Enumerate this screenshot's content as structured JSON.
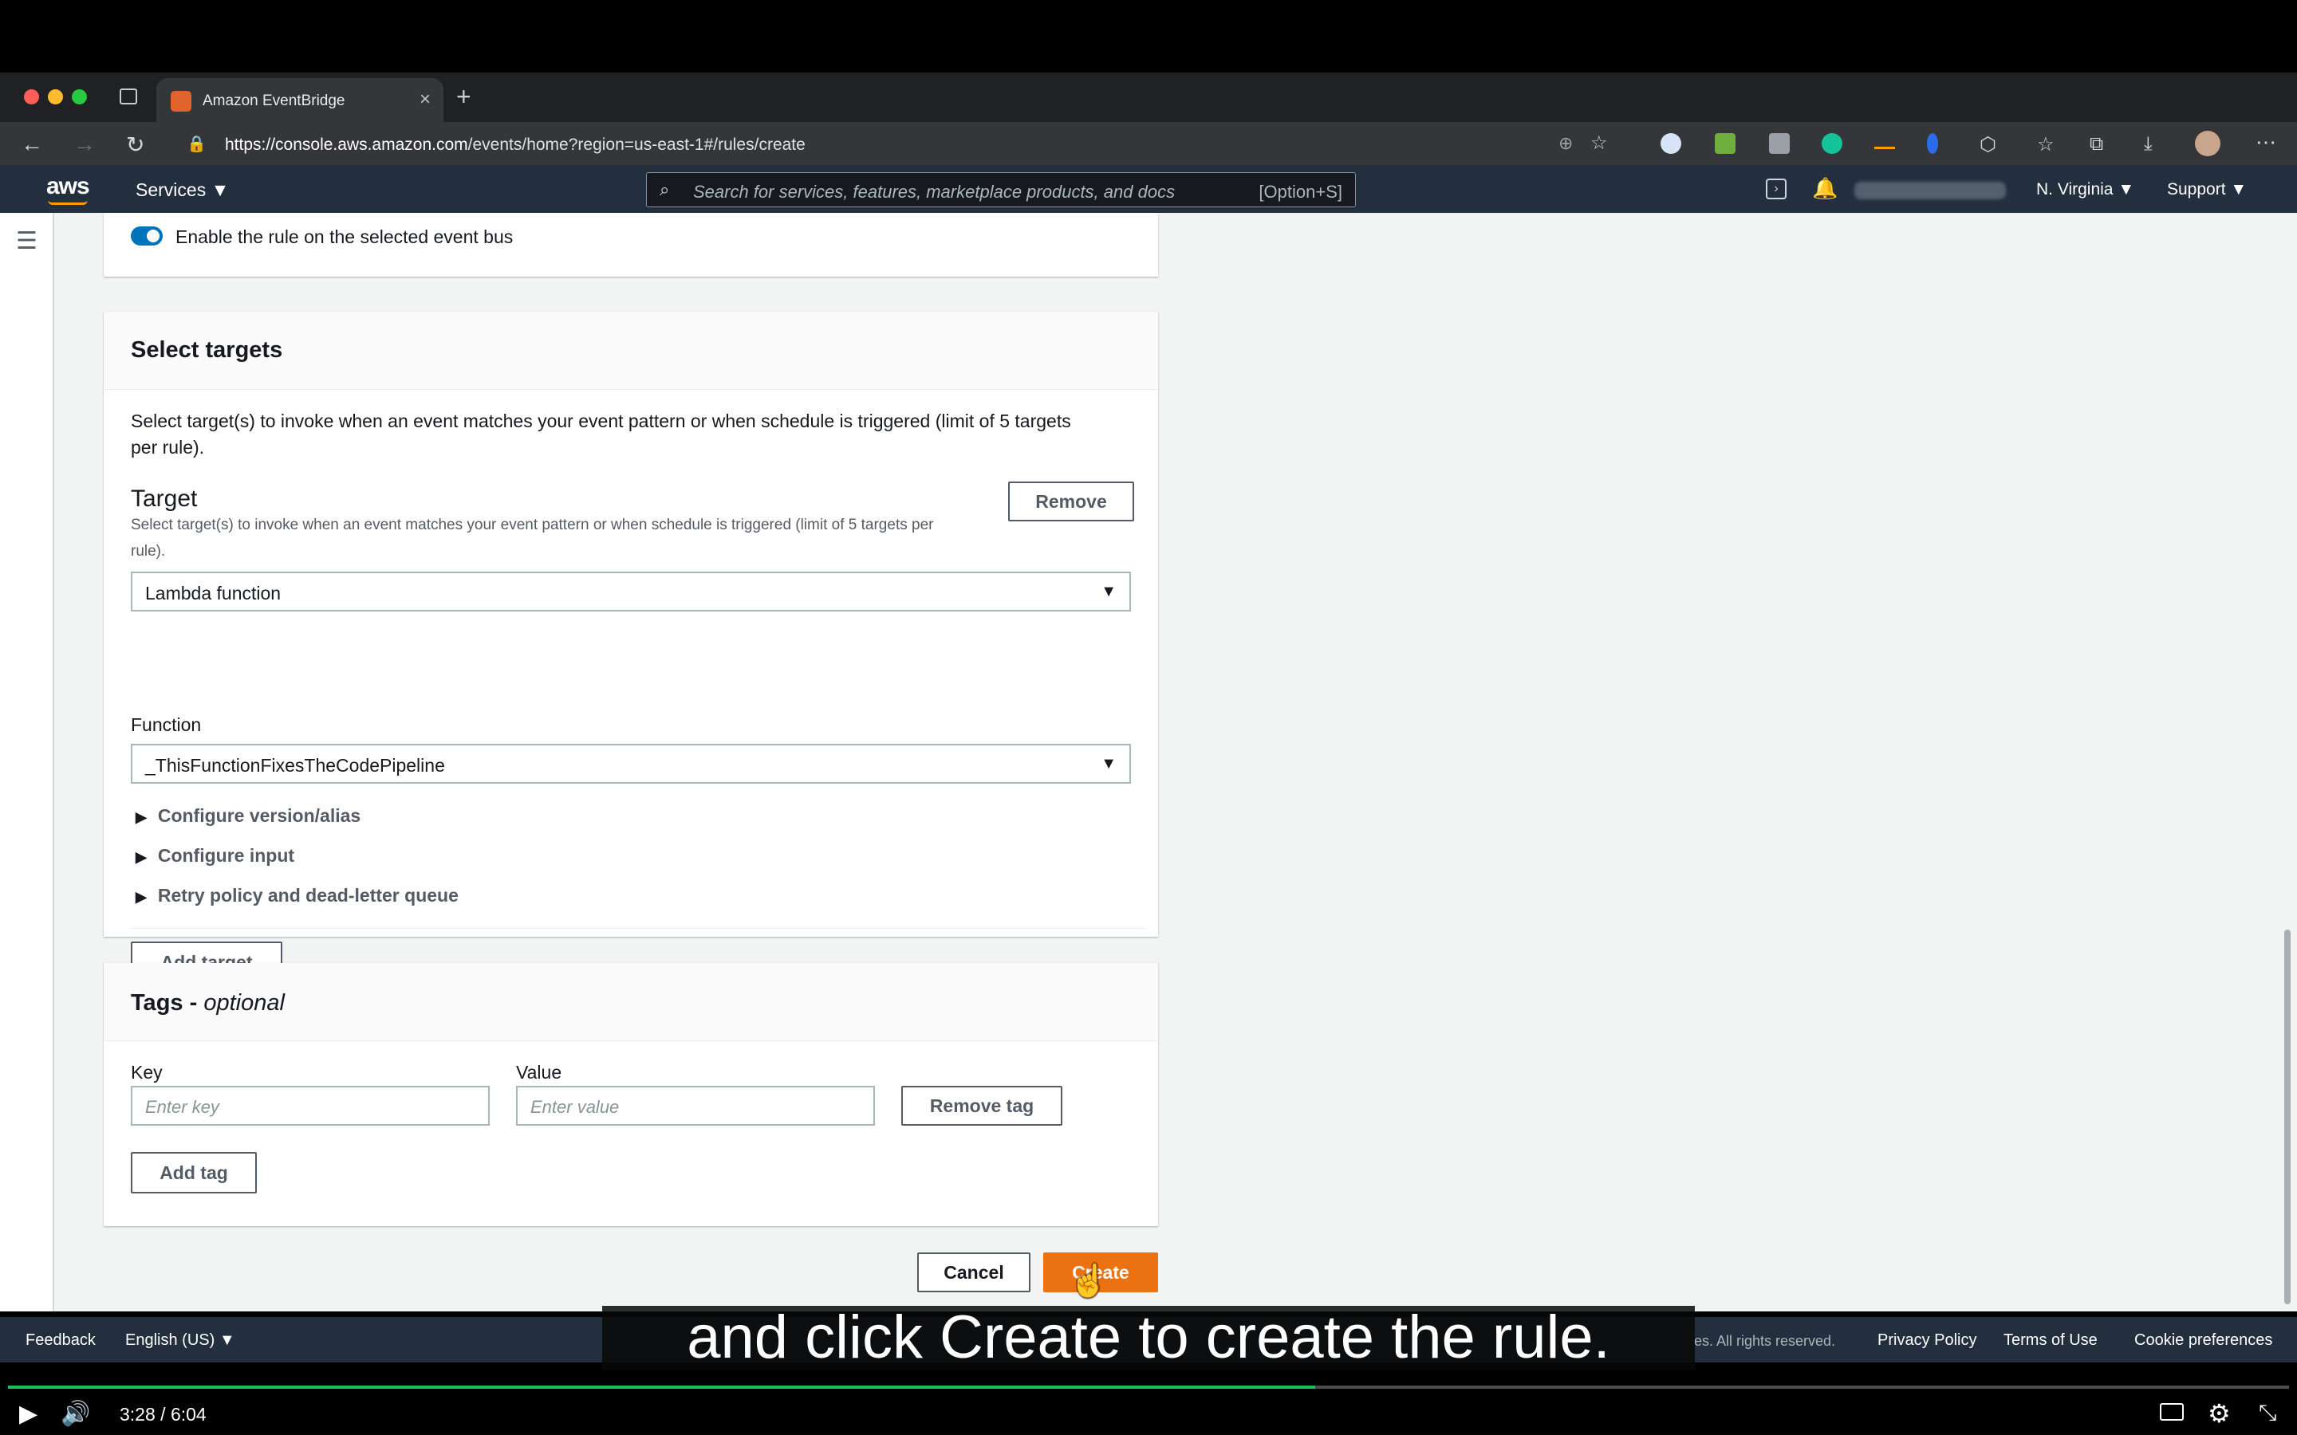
{
  "browser": {
    "tab_title": "Amazon EventBridge",
    "url_host": "https://console.aws.amazon.com",
    "url_path": "/events/home?region=us-east-1#/rules/create"
  },
  "aws_nav": {
    "logo": "aws",
    "services_label": "Services ▼",
    "search_placeholder": "Search for services, features, marketplace products, and docs",
    "search_shortcut": "[Option+S]",
    "region_label": "N. Virginia ▼",
    "support_label": "Support ▼"
  },
  "enable_rule": {
    "label": "Enable the rule on the selected event bus",
    "enabled": true
  },
  "select_targets": {
    "title": "Select targets",
    "description_line1": "Select target(s) to invoke when an event matches your event pattern or when schedule is triggered (limit of 5 targets",
    "description_line2": "per rule).",
    "target": {
      "label": "Target",
      "hint_line1": "Select target(s) to invoke when an event matches your event pattern or when schedule is triggered (limit of 5 targets per",
      "hint_line2": "rule).",
      "remove_label": "Remove",
      "type_value": "Lambda function",
      "function_label": "Function",
      "function_value": "_ThisFunctionFixesTheCodePipeline",
      "expanders": [
        "Configure version/alias",
        "Configure input",
        "Retry policy and dead-letter queue"
      ]
    },
    "add_target_label": "Add target"
  },
  "tags": {
    "title_main": "Tags - ",
    "title_optional": "optional",
    "key_label": "Key",
    "key_placeholder": "Enter key",
    "value_label": "Value",
    "value_placeholder": "Enter value",
    "remove_tag_label": "Remove tag",
    "add_tag_label": "Add tag"
  },
  "actions": {
    "cancel_label": "Cancel",
    "create_label": "Create"
  },
  "footer": {
    "feedback": "Feedback",
    "language": "English (US) ▼",
    "rights": "es. All rights reserved.",
    "privacy": "Privacy Policy",
    "terms": "Terms of Use",
    "cookies": "Cookie preferences"
  },
  "caption": "and click Create to create the rule.",
  "video": {
    "current_time": "3:28",
    "separator": "/",
    "duration": "6:04",
    "progress": 0.573
  },
  "colors": {
    "aws_nav_bg": "#232f3e",
    "primary_button": "#ec7211",
    "toggle_on": "#0073bb",
    "video_progress": "#16c05a"
  }
}
